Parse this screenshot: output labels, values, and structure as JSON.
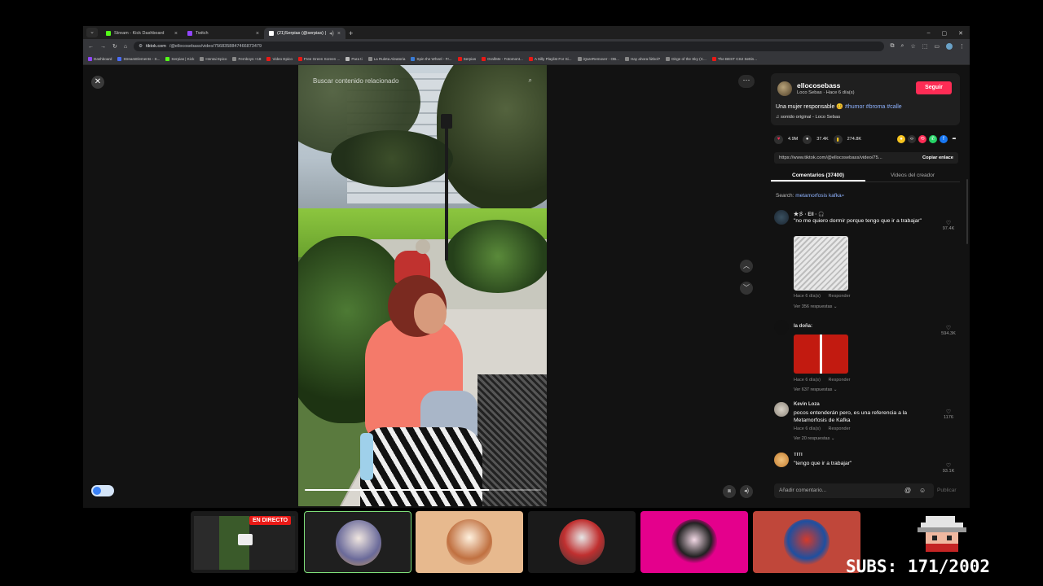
{
  "browser": {
    "tabs": [
      {
        "label": "Stream - Kick Dashboard",
        "color": "#53fc18",
        "active": false
      },
      {
        "label": "Twitch",
        "color": "#9146ff",
        "active": false
      },
      {
        "label": "(21)Serpias (@serpias) | Ti...",
        "color": "#ffffff",
        "active": true
      }
    ],
    "url_domain": "tiktok.com",
    "url_path": "/@ellocosebass/video/7568358847466873479",
    "bookmarks": [
      "Dashboard",
      "StreamElements - S...",
      "Serpias | Kick",
      "Hentai Epico",
      "Femboys +18",
      "Video Epico",
      "Free Green Screen ...",
      "Para ti",
      "La Ruleta Aleatoria",
      "Spin the Wheel - Fr...",
      "Serpias",
      "GrafiMe - Fotomont...",
      "A Silly Playlist For Si...",
      "iQareRemover - OB...",
      "Hay ahora fútbol?",
      "Dirge of the Sky (C...",
      "The BEST CS2 Settin..."
    ]
  },
  "video": {
    "search_placeholder": "Buscar contenido relacionado",
    "progress": 0.78
  },
  "creator": {
    "username": "ellocosebass",
    "subtitle": "Loco Sebas · Hace 6 día(s)",
    "follow_label": "Seguir",
    "description": "Una mujer responsable 🥴",
    "hashtags": "#humor #broma #calle",
    "sound": "sonido original - Loco Sebas"
  },
  "stats": {
    "likes": "4.9M",
    "comments": "37.4K",
    "saves": "274.8K"
  },
  "link": {
    "url": "https://www.tiktok.com/@ellocosebass/video/75...",
    "copy_label": "Copiar enlace"
  },
  "panel_tabs": {
    "comments": "Comentarios (37400)",
    "creator_videos": "Videos del creador"
  },
  "search": {
    "label": "Search:",
    "query": "metamorfosis kafka"
  },
  "comments": [
    {
      "user": "★彡 · Ell · 🎧",
      "text": "\"no me quiero dormir porque tengo que ir a trabajar\"",
      "time": "Hace 6 día(s)",
      "reply": "Responder",
      "replies": "Ver 356 respuestas ⌄",
      "likes": "97.4K"
    },
    {
      "user": "la doña:",
      "text": "",
      "time": "Hace 6 día(s)",
      "reply": "Responder",
      "replies": "Ver 637 respuestas ⌄",
      "likes": "594.3K"
    },
    {
      "user": "Kevin Loza",
      "text": "pocos entenderán pero, es una referencia a la Metamorfosis de Kafka",
      "time": "Hace 6 día(s)",
      "reply": "Responder",
      "replies": "Ver 20 respuestas ⌄",
      "likes": "1176"
    },
    {
      "user": "TITI",
      "text": "\"tengo que ir a trabajar\"",
      "likes": "93.1K"
    }
  ],
  "add_comment": {
    "placeholder": "Añadir comentario...",
    "publish": "Publicar"
  },
  "stream": {
    "live_label": "EN DIRECTO",
    "subs_label": "SUBS: 171/2002"
  },
  "colors": {
    "accent": "#fe2c55",
    "hashtag": "#8fb3ff",
    "live": "#e91916",
    "thumb_bg": [
      "#1a1a1a",
      "#1f1f1f",
      "#e7b98e",
      "#1a1a1a",
      "#e4008c",
      "#c0473a"
    ]
  }
}
